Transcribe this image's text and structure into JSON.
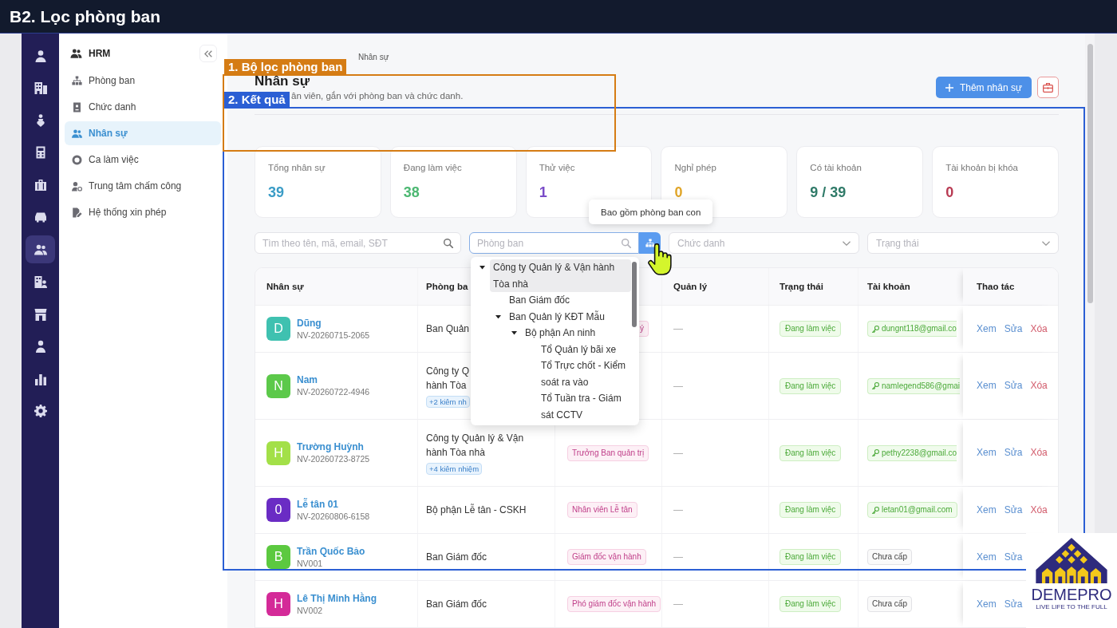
{
  "header_bar": {
    "title": "B2. Lọc phòng ban"
  },
  "icon_rail": [
    {
      "selected": false
    },
    {
      "selected": false
    },
    {
      "selected": false
    },
    {
      "selected": false
    },
    {
      "selected": false
    },
    {
      "selected": false
    },
    {
      "selected": true
    },
    {
      "selected": false
    },
    {
      "selected": false
    },
    {
      "selected": false
    },
    {
      "selected": false
    },
    {
      "selected": false
    }
  ],
  "sidebar": {
    "title": "HRM",
    "items": [
      {
        "label": "Phòng ban",
        "selected": false
      },
      {
        "label": "Chức danh",
        "selected": false
      },
      {
        "label": "Nhân sự",
        "selected": true
      },
      {
        "label": "Ca làm việc",
        "selected": false
      },
      {
        "label": "Trung tâm chấm công",
        "selected": false
      },
      {
        "label": "Hệ thống xin phép",
        "selected": false
      }
    ]
  },
  "page_header": {
    "breadcrumb": "Nhân sự",
    "title": "Nhân sự",
    "subtitle": "ân viên, gắn với phòng ban và chức danh.",
    "add_button": "Thêm nhân sự"
  },
  "stats": [
    {
      "label": "Tổng nhân sự",
      "value": "39",
      "color": "#3a9cc6"
    },
    {
      "label": "Đang làm việc",
      "value": "38",
      "color": "#4cb872"
    },
    {
      "label": "Thử việc",
      "value": "1",
      "color": "#7a4cc8"
    },
    {
      "label": "Nghỉ phép",
      "value": "0",
      "color": "#e0a528"
    },
    {
      "label": "Có tài khoản",
      "value": "9 / 39",
      "color": "#2f7a68"
    },
    {
      "label": "Tài khoản bị khóa",
      "value": "0",
      "color": "#b83a52"
    }
  ],
  "tooltip": "Bao gồm phòng ban con",
  "filters": {
    "search": {
      "placeholder": "Tìm theo tên, mã, email, SĐT"
    },
    "department": {
      "placeholder": "Phòng ban",
      "focused": true
    },
    "position": {
      "placeholder": "Chức danh"
    },
    "status": {
      "placeholder": "Trạng thái"
    }
  },
  "department_tree": [
    {
      "label": "Công ty Quản lý & Vận hành Tòa nhà",
      "selected": true,
      "expanded": true,
      "children": [
        {
          "label": "Ban Giám đốc",
          "selected": false
        },
        {
          "label": "Ban Quản lý KĐT Mẫu",
          "selected": false,
          "expanded": true,
          "children": [
            {
              "label": "Bộ phận An ninh",
              "selected": false,
              "expanded": true,
              "children": [
                {
                  "label": "Tổ Quản lý bãi xe",
                  "selected": false
                },
                {
                  "label": "Tổ Trực chốt - Kiểm soát ra vào",
                  "selected": false
                },
                {
                  "label": "Tổ Tuần tra - Giám sát CCTV",
                  "selected": false
                }
              ]
            }
          ]
        }
      ]
    }
  ],
  "table": {
    "columns": [
      "Nhân sự",
      "Phòng ba",
      "Quản lý",
      "Trạng thái",
      "Tài khoản",
      "Thao tác"
    ],
    "rows": [
      {
        "avatar": "D",
        "color": "#3fc1b0",
        "name": "Dũng",
        "code": "NV-20260715-2065",
        "department": "Ban Quản",
        "role": {
          "text": "ý",
          "clipped": true
        },
        "manager": "—",
        "status": "Đang làm việc",
        "account": {
          "kind": "email",
          "text": "dungnt118@gmail.co",
          "clipped": true
        },
        "actions": [
          {
            "kind": "view",
            "label": "Xem"
          },
          {
            "kind": "edit",
            "label": "Sửa"
          },
          {
            "kind": "delete",
            "label": "Xóa"
          }
        ]
      },
      {
        "avatar": "N",
        "color": "#5cc94a",
        "name": "Nam",
        "code": "NV-20260722-4946",
        "department": "Công ty Q\nhành Tòa",
        "concurrent": "+2 kiêm nh",
        "manager": "—",
        "status": "Đang làm việc",
        "account": {
          "kind": "email",
          "text": "namlegend586@gmai",
          "clipped": true
        },
        "actions": [
          {
            "kind": "view",
            "label": "Xem"
          },
          {
            "kind": "edit",
            "label": "Sửa"
          },
          {
            "kind": "delete",
            "label": "Xóa"
          }
        ]
      },
      {
        "avatar": "H",
        "color": "#a3e048",
        "name": "Trường Huỳnh",
        "code": "NV-20260723-8725",
        "department": "Công ty Quản lý & Vận hành Tòa nhà",
        "concurrent": "+4 kiêm nhiệm",
        "role": {
          "text": "Trưởng Ban quản trị",
          "clipped": false
        },
        "manager": "—",
        "status": "Đang làm việc",
        "account": {
          "kind": "email",
          "text": "pethy2238@gmail.co",
          "clipped": true
        },
        "actions": [
          {
            "kind": "view",
            "label": "Xem"
          },
          {
            "kind": "edit",
            "label": "Sửa"
          },
          {
            "kind": "delete",
            "label": "Xóa"
          }
        ]
      },
      {
        "avatar": "0",
        "color": "#6a2cc4",
        "name": "Lễ tân 01",
        "code": "NV-20260806-6158",
        "department": "Bộ phận Lễ tân - CSKH",
        "role": {
          "text": "Nhân viên Lễ tân",
          "clipped": false
        },
        "manager": "—",
        "status": "Đang làm việc",
        "account": {
          "kind": "email",
          "text": "letan01@gmail.com",
          "clipped": false
        },
        "actions": [
          {
            "kind": "view",
            "label": "Xem"
          },
          {
            "kind": "edit",
            "label": "Sửa"
          },
          {
            "kind": "delete",
            "label": "Xóa"
          }
        ]
      },
      {
        "avatar": "B",
        "color": "#5cc940",
        "name": "Trần Quốc Bảo",
        "code": "NV001",
        "department": "Ban Giám đốc",
        "role": {
          "text": "Giám đốc vận hành",
          "clipped": false
        },
        "manager": "—",
        "status": "Đang làm việc",
        "account": {
          "kind": "none",
          "text": "Chưa cấp",
          "clipped": false
        },
        "actions": [
          {
            "kind": "view",
            "label": "Xem"
          },
          {
            "kind": "edit",
            "label": "Sửa"
          }
        ]
      },
      {
        "avatar": "H",
        "color": "#d42a98",
        "name": "Lê Thị Minh Hằng",
        "code": "NV002",
        "department": "Ban Giám đốc",
        "role": {
          "text": "Phó giám đốc vận hành",
          "clipped": false
        },
        "manager": "—",
        "status": "Đang làm việc",
        "account": {
          "kind": "none",
          "text": "Chưa cấp",
          "clipped": false
        },
        "actions": [
          {
            "kind": "view",
            "label": "Xem"
          },
          {
            "kind": "edit",
            "label": "Sửa"
          }
        ]
      }
    ]
  },
  "annotations": [
    {
      "label": "1. Bộ lọc phòng ban",
      "color": "#d57c14"
    },
    {
      "label": "2. Kết quả",
      "color": "#2b5fd4"
    }
  ],
  "logo": {
    "brand": "DEMEPRO",
    "tagline": "LIVE LIFE TO THE FULL"
  }
}
